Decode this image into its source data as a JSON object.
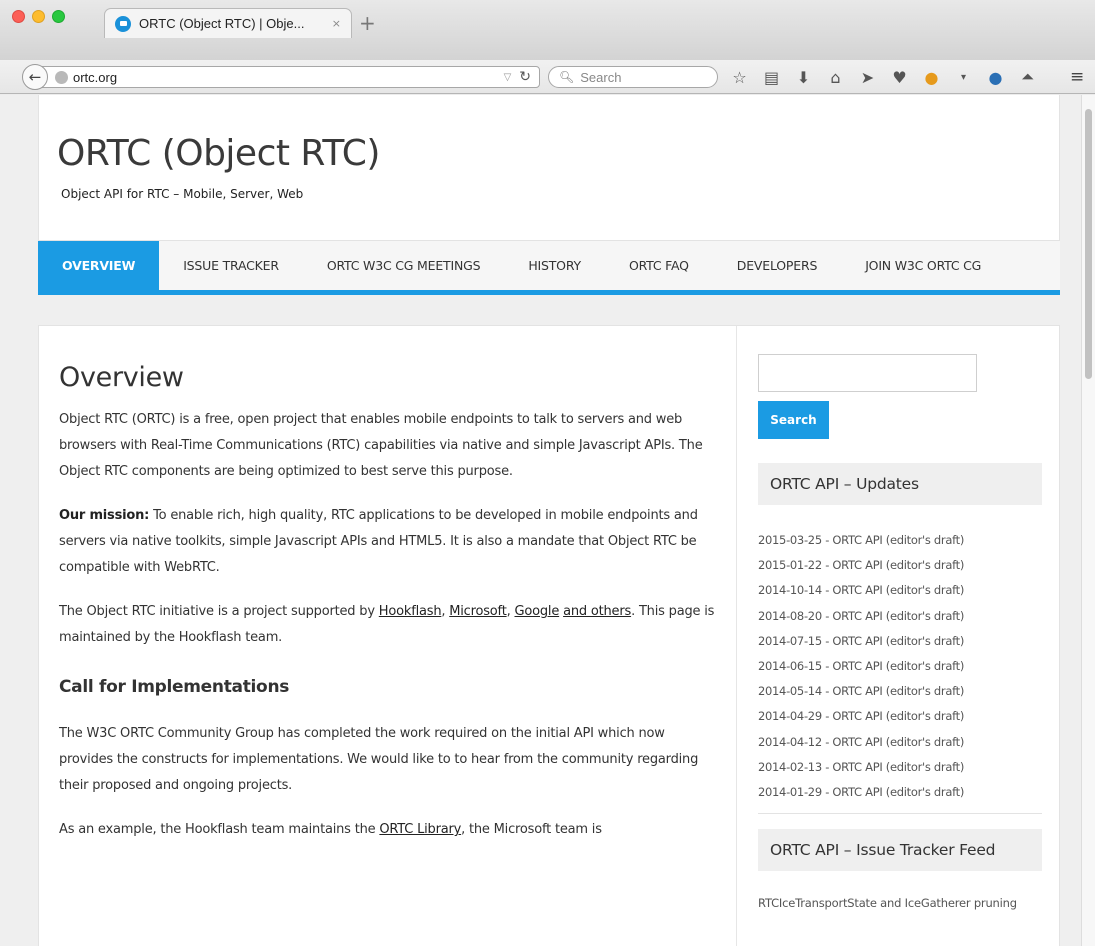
{
  "browser": {
    "tab_title": "ORTC (Object RTC) | Obje...",
    "tab_close": "×",
    "new_tab": "+",
    "url": "ortc.org",
    "search_placeholder": "Search",
    "icons": [
      "star-icon",
      "reading-list-icon",
      "download-icon",
      "home-icon",
      "send-icon",
      "pocket-icon",
      "extension-icon",
      "dropdown-icon",
      "globe-icon",
      "abp-icon"
    ]
  },
  "site": {
    "title": "ORTC (Object RTC)",
    "description": "Object API for RTC – Mobile, Server, Web"
  },
  "nav": {
    "items": [
      {
        "label": "OVERVIEW"
      },
      {
        "label": "ISSUE TRACKER"
      },
      {
        "label": "ORTC W3C CG MEETINGS"
      },
      {
        "label": "HISTORY"
      },
      {
        "label": "ORTC FAQ"
      },
      {
        "label": "DEVELOPERS"
      },
      {
        "label": "JOIN W3C ORTC CG"
      }
    ]
  },
  "main": {
    "title": "Overview",
    "p1": "Object RTC (ORTC) is a free, open project that enables mobile endpoints to talk to servers and web browsers with Real-Time Communications (RTC) capabilities via native and simple Javascript APIs. The Object RTC components are being optimized to best serve this purpose.",
    "mission_label": "Our mission:",
    "mission_text": " To enable rich, high quality, RTC applications to be developed in mobile endpoints and servers via native toolkits, simple Javascript APIs and HTML5. It is also a mandate that Object RTC be compatible with WebRTC.",
    "p3_start": "The Object RTC initiative is a project supported by ",
    "link_hookflash": "Hookflash",
    "comma1": ", ",
    "link_microsoft": "Microsoft",
    "comma2": ", ",
    "link_google": "Google",
    "space": " ",
    "link_others": "and others",
    "p3_end": ". This page is maintained by the Hookflash team.",
    "subtitle": "Call for Implementations",
    "p4": "The W3C ORTC Community Group has completed the work required on the initial API which now provides the constructs for implementations.  We would like to to hear from the community regarding their proposed and ongoing projects.",
    "p5_start": "As an example, the Hookflash team maintains the ",
    "link_ortc_library": "ORTC Library",
    "p5_end": ", the Microsoft team is"
  },
  "sidebar": {
    "search_button": "Search",
    "updates_title": "ORTC API – Updates",
    "updates": [
      "2015-03-25 - ORTC API (editor's draft)",
      "2015-01-22 - ORTC API (editor's draft)",
      "2014-10-14 - ORTC API (editor's draft)",
      "2014-08-20 - ORTC API (editor's draft)",
      "2014-07-15 - ORTC API (editor's draft)",
      "2014-06-15 - ORTC API (editor's draft)",
      "2014-05-14 - ORTC API (editor's draft)",
      "2014-04-29 - ORTC API (editor's draft)",
      "2014-04-12 - ORTC API (editor's draft)",
      "2014-02-13 - ORTC API (editor's draft)",
      "2014-01-29 - ORTC API (editor's draft)"
    ],
    "issues_title": "ORTC API – Issue Tracker Feed",
    "issue_item": "RTCIceTransportState and IceGatherer pruning"
  },
  "colors": {
    "accent": "#1b9be3"
  }
}
